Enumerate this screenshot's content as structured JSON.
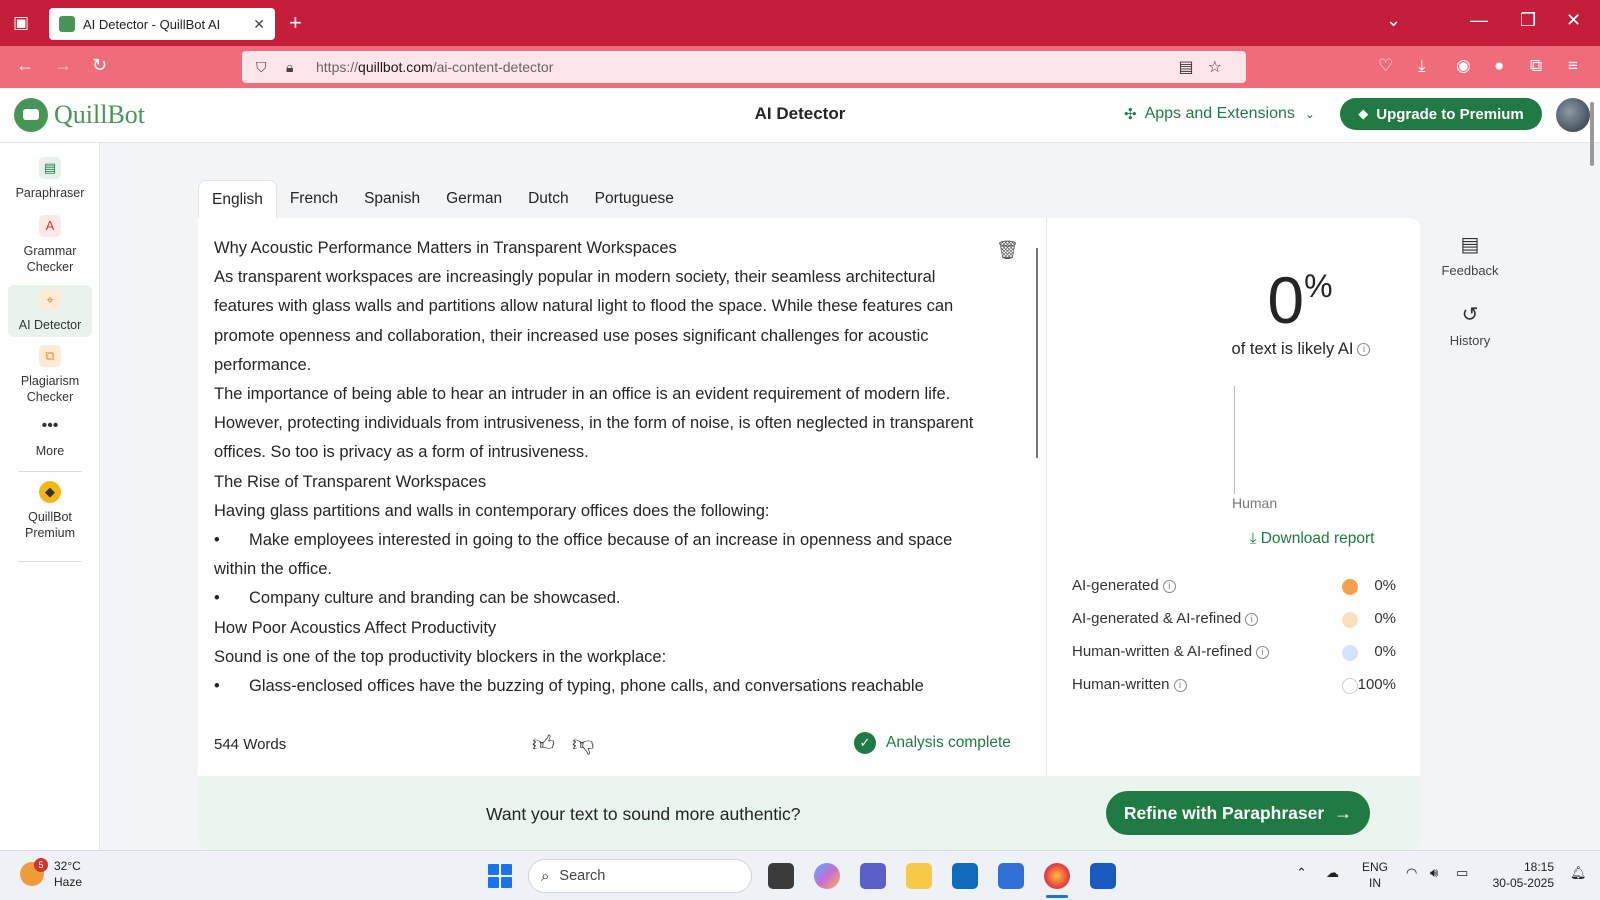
{
  "browser": {
    "tab_title": "AI Detector - QuillBot AI",
    "tab_close": "✕",
    "new_tab": "+",
    "url_host": "quillbot.com",
    "url_path": "/ai-content-detector",
    "url_scheme": "https://",
    "win_min": "—",
    "win_restore": "❐",
    "win_close": "✕",
    "tablist_icon": "⌄"
  },
  "app": {
    "logo_text": "QuillBot",
    "title": "AI Detector",
    "apps_extensions_label": "Apps and Extensions",
    "upgrade_label": "Upgrade to Premium",
    "accent_color": "#1f7a43"
  },
  "left_nav": {
    "items": [
      {
        "label": "Paraphraser"
      },
      {
        "label": "Grammar Checker"
      },
      {
        "label": "AI Detector"
      },
      {
        "label": "Plagiarism Checker"
      },
      {
        "label": "More"
      },
      {
        "label": "QuillBot Premium"
      }
    ]
  },
  "right_nav": {
    "feedback_label": "Feedback",
    "history_label": "History"
  },
  "languages": [
    "English",
    "French",
    "Spanish",
    "German",
    "Dutch",
    "Portuguese"
  ],
  "editor": {
    "paragraphs": [
      "Why Acoustic Performance Matters in Transparent Workspaces",
      "As transparent workspaces are increasingly popular in modern society, their seamless architectural features with glass walls and partitions allow natural light to flood the space. While these features can promote openness and collaboration, their increased use poses significant challenges for acoustic performance.",
      "The importance of being able to hear an intruder in an office is an evident requirement of modern life. However, protecting individuals from intrusiveness, in the form of noise, is often neglected in transparent offices. So too is privacy as a form of intrusiveness.",
      "The Rise of Transparent Workspaces",
      "Having glass partitions and walls in contemporary offices does the following:"
    ],
    "bullets": [
      "Make employees interested in going to the office because of an increase in openness and space within the office.",
      "Company culture and branding can be showcased."
    ],
    "paragraphs2": [
      "How Poor Acoustics Affect Productivity",
      "Sound is one of the top productivity blockers in the workplace:"
    ],
    "bullets2": [
      "Glass-enclosed offices have the buzzing of typing, phone calls, and conversations reachable"
    ],
    "bullet_char": "•",
    "word_count": "544 Words",
    "status": "Analysis complete"
  },
  "result": {
    "percent": "0",
    "percent_sign": "%",
    "caption": "of text is likely AI",
    "gauge_label": "Human",
    "download_label": "Download report",
    "legend": [
      {
        "label": "AI-generated",
        "value": "0%",
        "color": "#f5a04a"
      },
      {
        "label": "AI-generated & AI-refined",
        "value": "0%",
        "color": "#fde0c2"
      },
      {
        "label": "Human-written & AI-refined",
        "value": "0%",
        "color": "#d4e3fa"
      },
      {
        "label": "Human-written",
        "value": "100%",
        "color": "#ffffff"
      }
    ]
  },
  "banner": {
    "text": "Want your text to sound more authentic?",
    "button_label": "Refine with Paraphraser"
  },
  "taskbar": {
    "weather_temp": "32°C",
    "weather_desc": "Haze",
    "weather_badge": "5",
    "search_placeholder": "Search",
    "lang_line1": "ENG",
    "lang_line2": "IN",
    "time": "18:15",
    "date": "30-05-2025"
  }
}
